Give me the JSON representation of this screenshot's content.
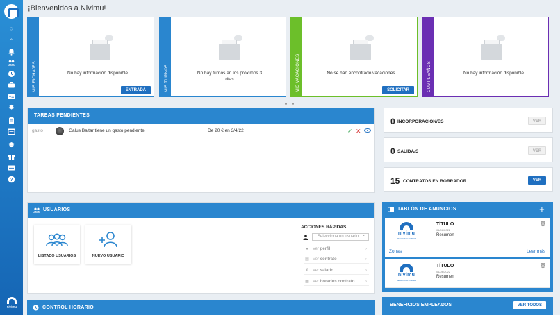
{
  "page_title": "¡Bienvenidos a Nivimu!",
  "colors": {
    "fichajes": "#2a86cf",
    "turnos": "#2a86cf",
    "vacaciones": "#6cbf2a",
    "cumpleanos": "#6b2fb3",
    "primary": "#1f6fc0"
  },
  "sidebar": {
    "icons": [
      "circle-icon",
      "home-icon",
      "bell-icon",
      "users-icon",
      "clock-icon",
      "briefcase-icon",
      "id-card-icon",
      "gear-icon",
      "clipboard-icon",
      "calendar-icon",
      "graduation-icon",
      "gift-icon",
      "monitor-icon",
      "help-icon"
    ],
    "brand": "nivimu"
  },
  "cards": [
    {
      "tab": "MIS FICHAJES",
      "message": "No hay información disponible",
      "button": "ENTRADA"
    },
    {
      "tab": "MIS TURNOS",
      "message": "No hay turnos en los próximos 3 días",
      "button": ""
    },
    {
      "tab": "MIS VACACIONES",
      "message": "No se han encontrado vacaciones",
      "button": "SOLICITAR"
    },
    {
      "tab": "CUMPLEAÑOS",
      "message": "No hay información disponible",
      "button": ""
    }
  ],
  "tasks": {
    "title": "TAREAS PENDIENTES",
    "rows": [
      {
        "type": "gasto",
        "text": "Galus Baltar tiene un gasto pendiente",
        "amount": "De 20 € en 3/4/22"
      }
    ]
  },
  "stats": [
    {
      "number": "0",
      "label": "INCORPORACIÓN/ES",
      "button": "VER",
      "enabled": false
    },
    {
      "number": "0",
      "label": "SALIDA/S",
      "button": "VER",
      "enabled": false
    },
    {
      "number": "15",
      "label": "CONTRATOS EN BORRADOR",
      "button": "VER",
      "enabled": true
    }
  ],
  "usuarios": {
    "title": "USUARIOS",
    "list_label": "LISTADO USUARIOS",
    "new_label": "NUEVO USUARIO",
    "quick_actions_title": "ACCIONES RÁPIDAS",
    "select_placeholder": "Selecciona un usuario",
    "actions": [
      {
        "prefix": "Ver",
        "bold": "perfil"
      },
      {
        "prefix": "Ver",
        "bold": "contrato"
      },
      {
        "prefix": "Ver",
        "bold": "salario"
      },
      {
        "prefix": "Ver",
        "bold": "horarios contrato"
      }
    ]
  },
  "tablon": {
    "title": "TABLÓN DE ANUNCIOS",
    "items": [
      {
        "title": "TÍTULO",
        "date": "01/06/2022",
        "summary": "Resumen"
      },
      {
        "title": "TÍTULO",
        "date": "01/06/2022",
        "summary": "Resumen"
      }
    ],
    "logo_word": "nivimu",
    "logo_tag": "REAL DATA FOR HR",
    "zonas": "Zonas",
    "leer_mas": "Leer más"
  },
  "control_horario": {
    "title": "CONTROL HORARIO"
  },
  "beneficios": {
    "title": "BENEFICIOS EMPLEADOS",
    "button": "VER TODOS"
  }
}
